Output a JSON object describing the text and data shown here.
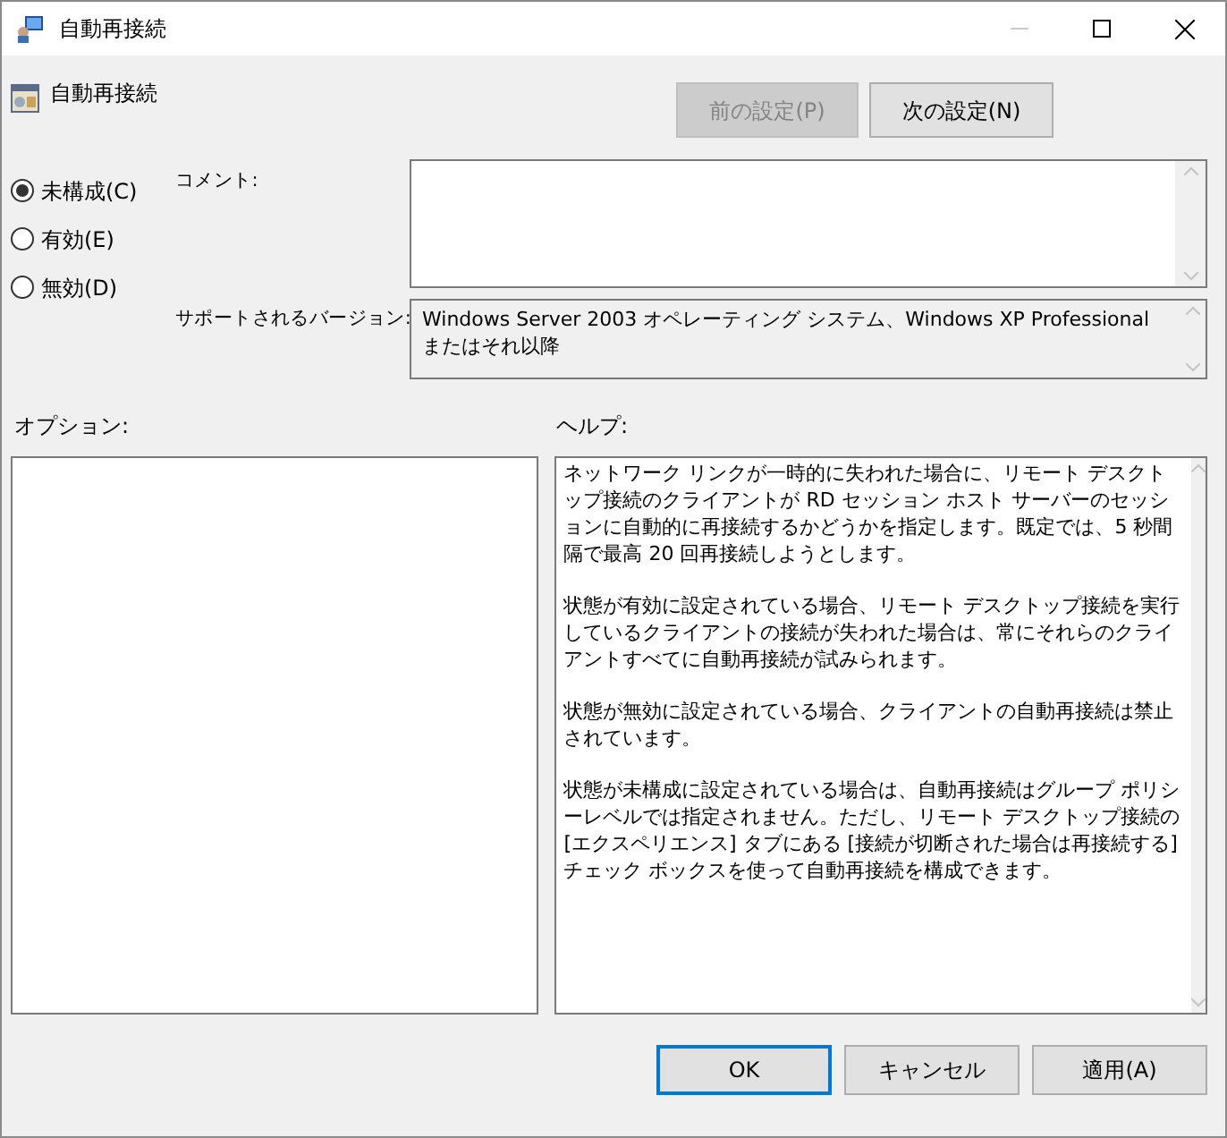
{
  "window": {
    "title": "自動再接続"
  },
  "header": {
    "title": "自動再接続"
  },
  "nav_buttons": [
    {
      "label": "前の設定(P)",
      "disabled": true
    },
    {
      "label": "次の設定(N)",
      "disabled": false
    }
  ],
  "state_options": [
    {
      "label": "未構成(C)",
      "selected": true
    },
    {
      "label": "有効(E)",
      "selected": false
    },
    {
      "label": "無効(D)",
      "selected": false
    }
  ],
  "comment": {
    "label": "コメント:"
  },
  "supported": {
    "label": "サポートされるバージョン:",
    "value": "Windows Server 2003 オペレーティング システム、Windows XP Professional またはそれ以降"
  },
  "options": {
    "label": "オプション:"
  },
  "help": {
    "label": "ヘルプ:",
    "paragraphs": [
      "ネットワーク リンクが一時的に失われた場合に、リモート デスクトップ接続のクライアントが RD セッション ホスト サーバーのセッションに自動的に再接続するかどうかを指定します。既定では、5 秒間隔で最高 20 回再接続しようとします。",
      "状態が有効に設定されている場合、リモート デスクトップ接続を実行しているクライアントの接続が失われた場合は、常にそれらのクライアントすべてに自動再接続が試みられます。",
      "状態が無効に設定されている場合、クライアントの自動再接続は禁止されています。",
      "状態が未構成に設定されている場合は、自動再接続はグループ ポリシーレベルでは指定されません。ただし、リモート デスクトップ接続の [エクスペリエンス] タブにある [接続が切断された場合は再接続する] チェック ボックスを使って自動再接続を構成できます。"
    ]
  },
  "footer_buttons": [
    {
      "label": "OK",
      "default": true
    },
    {
      "label": "キャンセル",
      "default": false
    },
    {
      "label": "適用(A)",
      "default": false
    }
  ]
}
